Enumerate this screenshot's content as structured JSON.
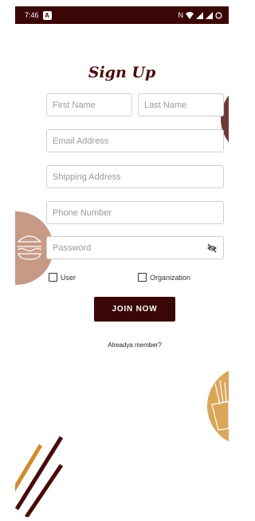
{
  "status_bar": {
    "time": "7:46",
    "app_glyph": "A",
    "icons": [
      "nfc-icon",
      "wifi-icon",
      "signal-icon",
      "signal-icon",
      "battery-icon"
    ]
  },
  "title": "Sign Up",
  "fields": {
    "first_name": "First Name",
    "last_name": "Last Name",
    "email": "Email Address",
    "shipping": "Shipping Address",
    "phone": "Phone Number",
    "password": "Password"
  },
  "account_types": {
    "user": "User",
    "organization": "Organization"
  },
  "join_label": "JOIN NOW",
  "member_text": "Alreadya member?",
  "colors": {
    "primary": "#3b0606",
    "pizza_circle": "#6e3a38",
    "burger_circle": "#c79a86",
    "fries_circle": "#d9a65a",
    "stripe_orange": "#d18a2c",
    "stripe_dark": "#4a0a0a"
  }
}
